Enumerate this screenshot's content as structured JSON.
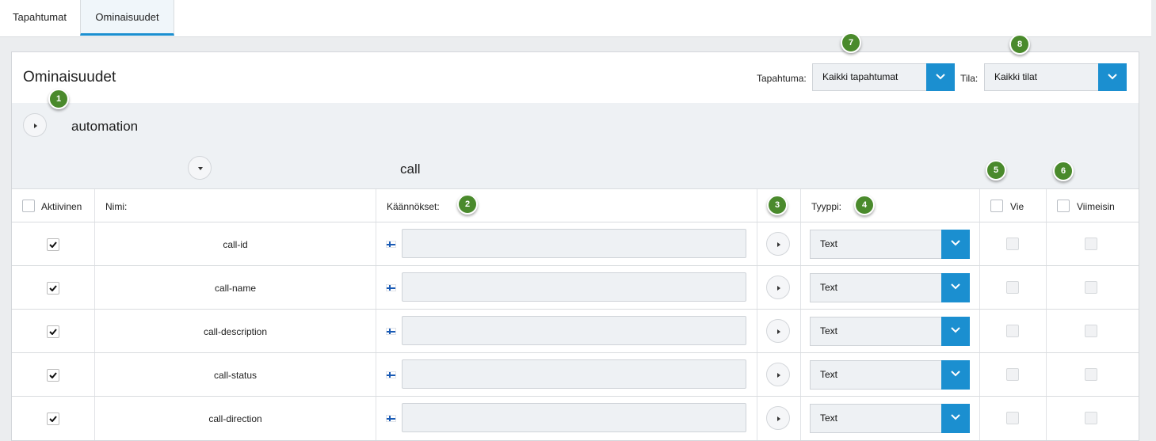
{
  "tabs": [
    {
      "label": "Tapahtumat"
    },
    {
      "label": "Ominaisuudet"
    }
  ],
  "panel": {
    "title": "Ominaisuudet",
    "filters": {
      "event_label": "Tapahtuma:",
      "event_value": "Kaikki tapahtumat",
      "state_label": "Tila:",
      "state_value": "Kaikki tilat"
    },
    "groups": {
      "outer": "automation",
      "inner": "call"
    }
  },
  "table": {
    "headers": {
      "active": "Aktiivinen",
      "name": "Nimi:",
      "translations": "Käännökset:",
      "type": "Tyyppi:",
      "export": "Vie",
      "latest": "Viimeisin"
    },
    "rows": [
      {
        "name": "call-id",
        "type": "Text",
        "active": true
      },
      {
        "name": "call-name",
        "type": "Text",
        "active": true
      },
      {
        "name": "call-description",
        "type": "Text",
        "active": true
      },
      {
        "name": "call-status",
        "type": "Text",
        "active": true
      },
      {
        "name": "call-direction",
        "type": "Text",
        "active": true
      }
    ]
  },
  "badges": [
    "1",
    "2",
    "3",
    "4",
    "5",
    "6",
    "7",
    "8"
  ],
  "colors": {
    "accent": "#1b8fd0",
    "badge": "#4a8a2c",
    "field_bg": "#eef1f4"
  },
  "icons": {
    "expand": "caret-right-icon",
    "collapse": "caret-down-icon",
    "dropdown": "chevron-down-icon",
    "flag": "finland-flag-icon",
    "check": "checkmark-icon"
  }
}
